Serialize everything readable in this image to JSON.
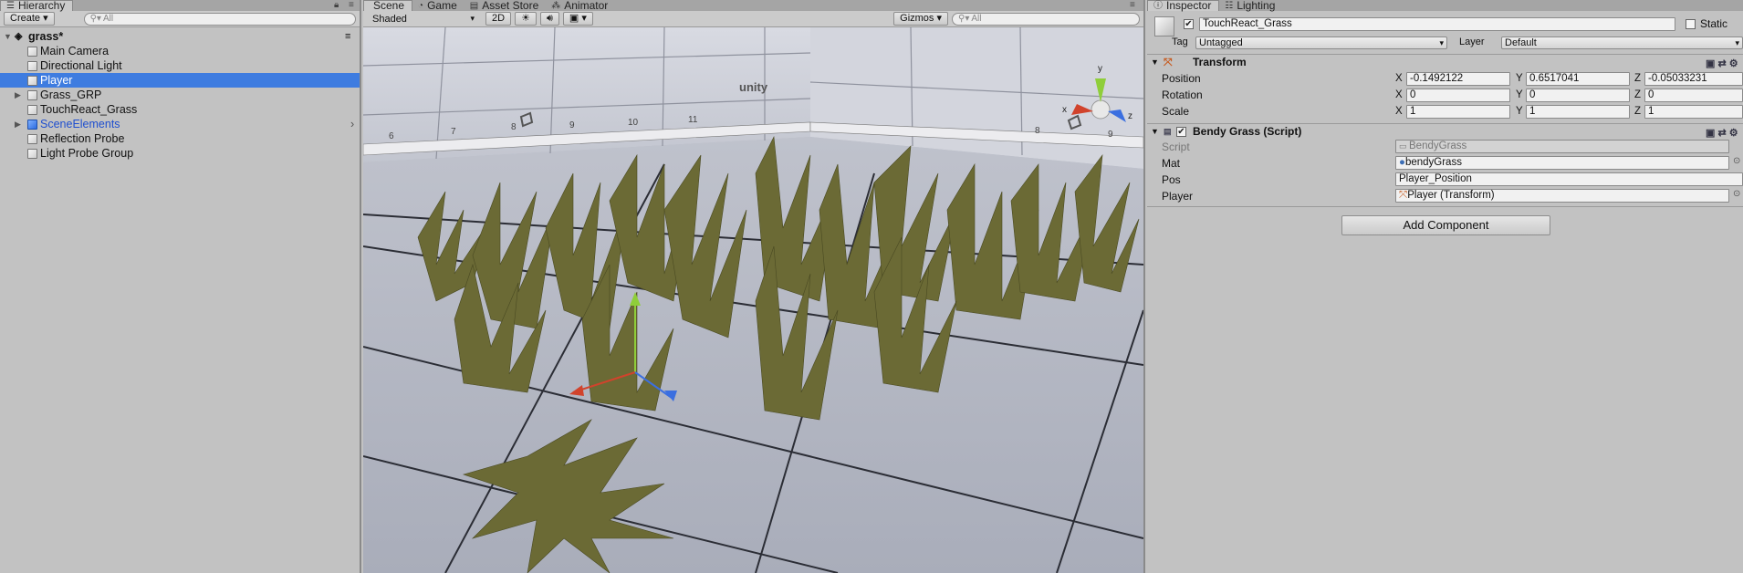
{
  "hierarchy": {
    "tab": "Hierarchy",
    "create": "Create",
    "search_placeholder": "All",
    "scene_name": "grass*",
    "items": [
      {
        "label": "Main Camera"
      },
      {
        "label": "Directional Light"
      },
      {
        "label": "Player"
      },
      {
        "label": "Grass_GRP"
      },
      {
        "label": "TouchReact_Grass"
      },
      {
        "label": "SceneElements"
      },
      {
        "label": "Reflection Probe"
      },
      {
        "label": "Light Probe Group"
      }
    ]
  },
  "scene": {
    "tabs": [
      {
        "label": "Scene"
      },
      {
        "label": "Game"
      },
      {
        "label": "Asset Store"
      },
      {
        "label": "Animator"
      }
    ],
    "shading": "Shaded",
    "mode_2d": "2D",
    "gizmos": "Gizmos",
    "search_placeholder": "All",
    "ruler_numbers": [
      "6",
      "7",
      "8",
      "9",
      "10",
      "11",
      "8",
      "9"
    ],
    "unity_text": "unity",
    "gizmo_axes": {
      "y": "y",
      "x": "x",
      "z": "z"
    },
    "colors": {
      "x": "#d1432c",
      "y": "#8fce3a",
      "z": "#3b6fe0"
    }
  },
  "inspector": {
    "tabs": [
      {
        "label": "Inspector"
      },
      {
        "label": "Lighting"
      }
    ],
    "object_name": "TouchReact_Grass",
    "static_label": "Static",
    "tag_label": "Tag",
    "tag_value": "Untagged",
    "layer_label": "Layer",
    "layer_value": "Default",
    "transform": {
      "title": "Transform",
      "position_label": "Position",
      "rotation_label": "Rotation",
      "scale_label": "Scale",
      "x_label": "X",
      "y_label": "Y",
      "z_label": "Z",
      "position": {
        "x": "-0.1492122",
        "y": "0.6517041",
        "z": "-0.05033231"
      },
      "rotation": {
        "x": "0",
        "y": "0",
        "z": "0"
      },
      "scale": {
        "x": "1",
        "y": "1",
        "z": "1"
      }
    },
    "script_comp": {
      "title": "Bendy Grass (Script)",
      "script_label": "Script",
      "script_value": "BendyGrass",
      "mat_label": "Mat",
      "mat_value": "bendyGrass",
      "pos_label": "Pos",
      "pos_value": "Player_Position",
      "player_label": "Player",
      "player_value": "Player (Transform)"
    },
    "add_component": "Add Component"
  },
  "colors": {
    "selection": "#3e7ce0",
    "panel": "#c2c2c2"
  }
}
